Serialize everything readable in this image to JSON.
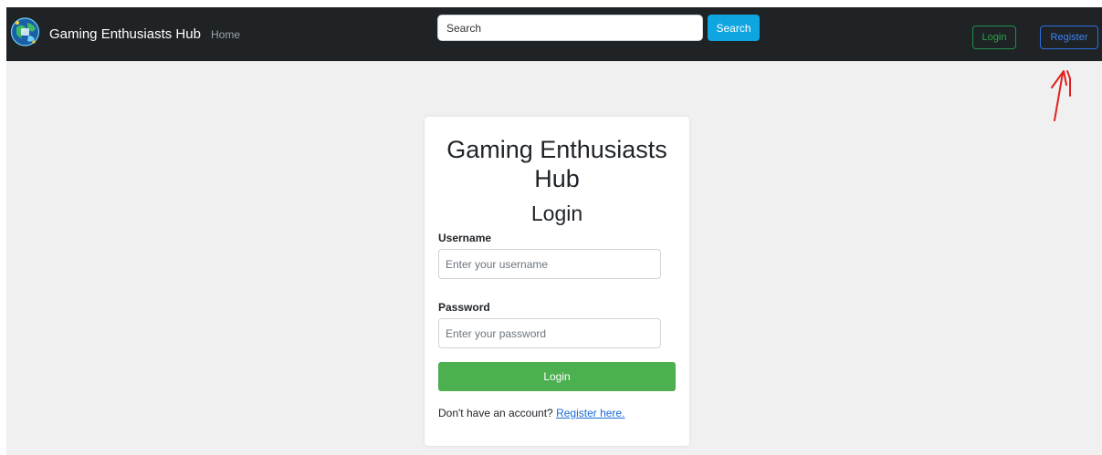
{
  "navbar": {
    "brand": "Gaming Enthusiasts Hub",
    "home_link": "Home",
    "search_placeholder": "Search",
    "search_button": "Search",
    "login_button": "Login",
    "register_button": "Register"
  },
  "login_card": {
    "title": "Gaming Enthusiasts Hub",
    "subtitle": "Login",
    "username_label": "Username",
    "username_placeholder": "Enter your username",
    "password_label": "Password",
    "password_placeholder": "Enter your password",
    "submit_button": "Login",
    "register_prompt": "Don't have an account?",
    "register_link": "Register here."
  },
  "colors": {
    "navbar_bg": "#1f2326",
    "search_button": "#0ea5e0",
    "login_outline": "#28a745",
    "register_outline": "#3b82f6",
    "submit_button": "#4caf50",
    "page_bg": "#f0f0f0",
    "annotation": "#e02020"
  },
  "icons": {
    "logo": "globe-logo-icon",
    "annotation": "red-arrow-annotation-icon"
  }
}
